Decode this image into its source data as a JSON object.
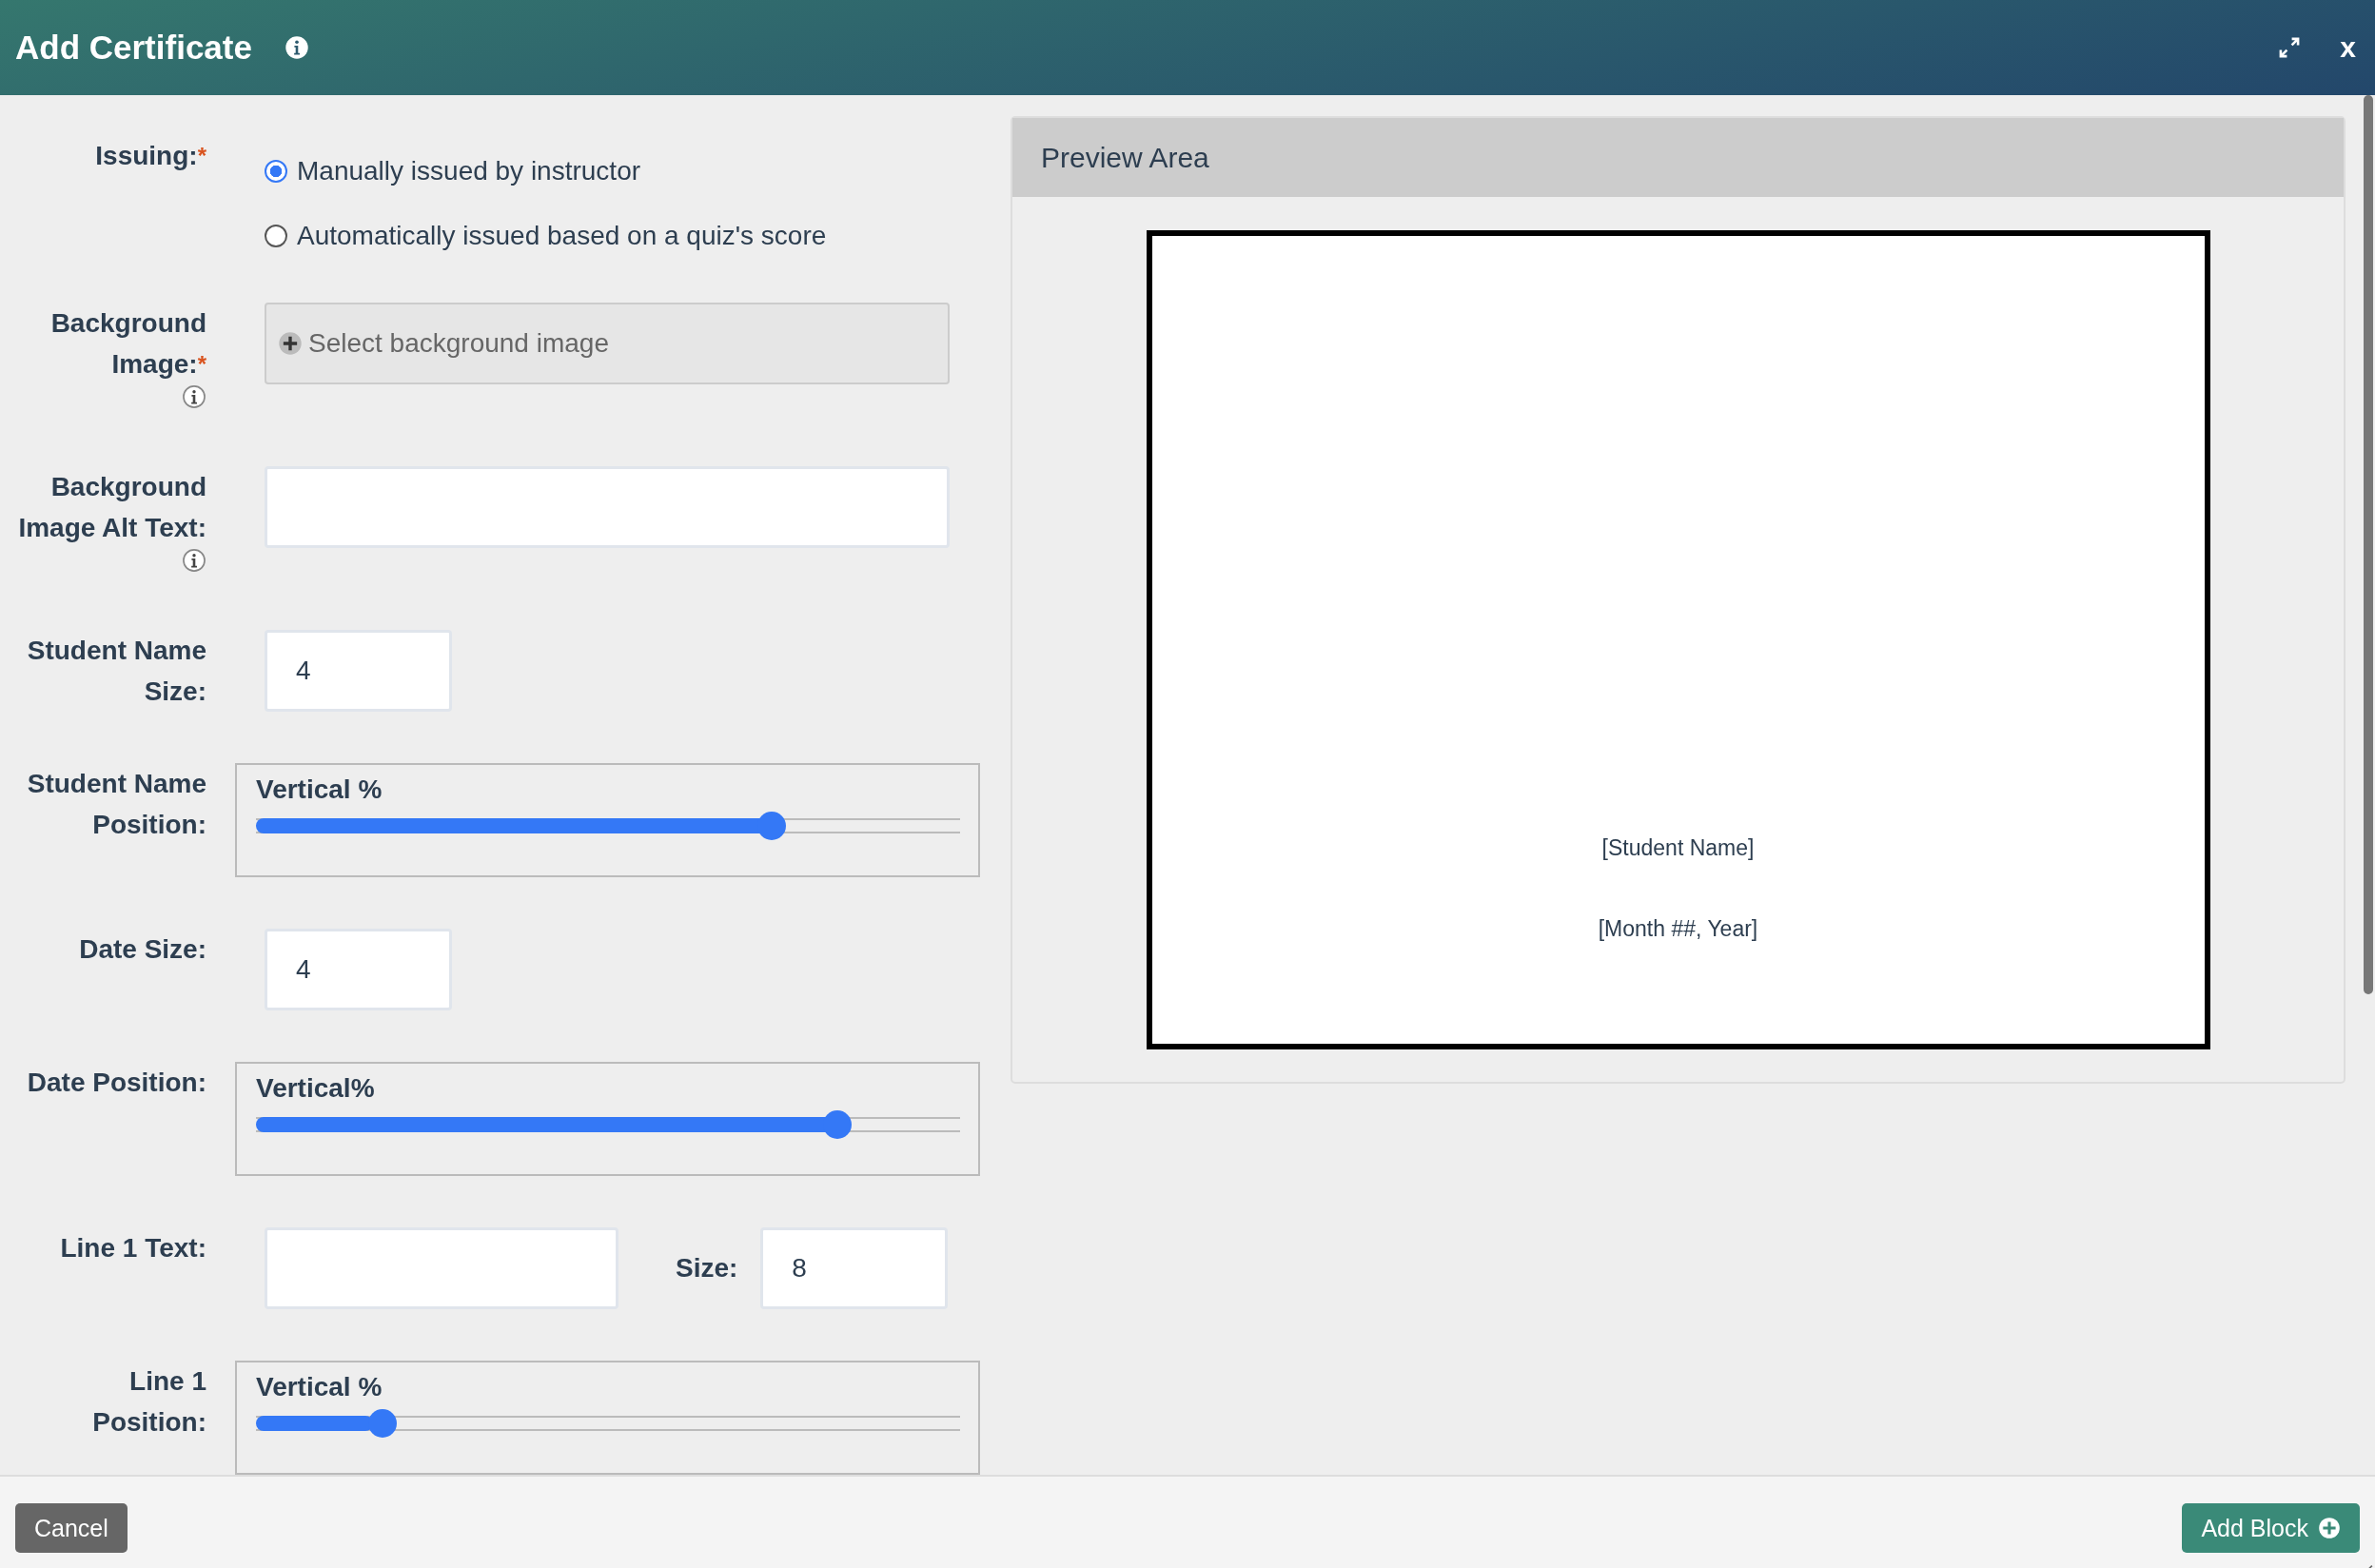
{
  "window": {
    "title": "Add Certificate",
    "close_label": "x"
  },
  "form": [
    {
      "kind": "radio",
      "label": "Issuing:",
      "required_mark": "*",
      "options": [
        {
          "label": "Manually issued by instructor",
          "selected": true
        },
        {
          "label": "Automatically issued based on a quiz's score",
          "selected": false
        }
      ]
    },
    {
      "kind": "picker",
      "label": "Background Image:",
      "required_mark": "*",
      "info": true,
      "placeholder": "Select background image"
    },
    {
      "kind": "text",
      "label": "Background Image Alt Text:",
      "info": true
    },
    {
      "kind": "number",
      "label": "Student Name Size:",
      "value": "4"
    },
    {
      "kind": "slider",
      "label": "Student Name Position:",
      "caption": "Vertical %",
      "level": 0.742
    },
    {
      "kind": "number",
      "label": "Date Size:",
      "value": "4"
    },
    {
      "kind": "slider",
      "label": "Date Position:",
      "caption": "Vertical%",
      "level": 0.839
    },
    {
      "kind": "text_size",
      "label": "Line 1 Text:",
      "size_label": "Size:",
      "size_value": "8"
    },
    {
      "kind": "slider",
      "label": "Line 1 Position:",
      "caption": "Vertical %",
      "level": 0.166
    }
  ],
  "preview": {
    "title": "Preview Area",
    "texts": [
      "[Student Name]",
      "[Month ##, Year]"
    ]
  },
  "footer": {
    "cancel": "Cancel",
    "add": "Add Block"
  }
}
